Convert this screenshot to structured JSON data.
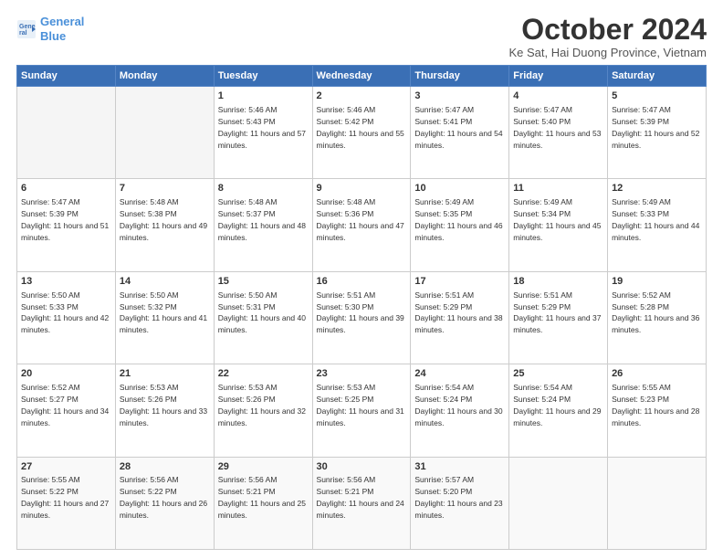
{
  "logo": {
    "line1": "General",
    "line2": "Blue"
  },
  "title": "October 2024",
  "subtitle": "Ke Sat, Hai Duong Province, Vietnam",
  "days_header": [
    "Sunday",
    "Monday",
    "Tuesday",
    "Wednesday",
    "Thursday",
    "Friday",
    "Saturday"
  ],
  "weeks": [
    [
      {
        "num": "",
        "sunrise": "",
        "sunset": "",
        "daylight": ""
      },
      {
        "num": "",
        "sunrise": "",
        "sunset": "",
        "daylight": ""
      },
      {
        "num": "1",
        "sunrise": "Sunrise: 5:46 AM",
        "sunset": "Sunset: 5:43 PM",
        "daylight": "Daylight: 11 hours and 57 minutes."
      },
      {
        "num": "2",
        "sunrise": "Sunrise: 5:46 AM",
        "sunset": "Sunset: 5:42 PM",
        "daylight": "Daylight: 11 hours and 55 minutes."
      },
      {
        "num": "3",
        "sunrise": "Sunrise: 5:47 AM",
        "sunset": "Sunset: 5:41 PM",
        "daylight": "Daylight: 11 hours and 54 minutes."
      },
      {
        "num": "4",
        "sunrise": "Sunrise: 5:47 AM",
        "sunset": "Sunset: 5:40 PM",
        "daylight": "Daylight: 11 hours and 53 minutes."
      },
      {
        "num": "5",
        "sunrise": "Sunrise: 5:47 AM",
        "sunset": "Sunset: 5:39 PM",
        "daylight": "Daylight: 11 hours and 52 minutes."
      }
    ],
    [
      {
        "num": "6",
        "sunrise": "Sunrise: 5:47 AM",
        "sunset": "Sunset: 5:39 PM",
        "daylight": "Daylight: 11 hours and 51 minutes."
      },
      {
        "num": "7",
        "sunrise": "Sunrise: 5:48 AM",
        "sunset": "Sunset: 5:38 PM",
        "daylight": "Daylight: 11 hours and 49 minutes."
      },
      {
        "num": "8",
        "sunrise": "Sunrise: 5:48 AM",
        "sunset": "Sunset: 5:37 PM",
        "daylight": "Daylight: 11 hours and 48 minutes."
      },
      {
        "num": "9",
        "sunrise": "Sunrise: 5:48 AM",
        "sunset": "Sunset: 5:36 PM",
        "daylight": "Daylight: 11 hours and 47 minutes."
      },
      {
        "num": "10",
        "sunrise": "Sunrise: 5:49 AM",
        "sunset": "Sunset: 5:35 PM",
        "daylight": "Daylight: 11 hours and 46 minutes."
      },
      {
        "num": "11",
        "sunrise": "Sunrise: 5:49 AM",
        "sunset": "Sunset: 5:34 PM",
        "daylight": "Daylight: 11 hours and 45 minutes."
      },
      {
        "num": "12",
        "sunrise": "Sunrise: 5:49 AM",
        "sunset": "Sunset: 5:33 PM",
        "daylight": "Daylight: 11 hours and 44 minutes."
      }
    ],
    [
      {
        "num": "13",
        "sunrise": "Sunrise: 5:50 AM",
        "sunset": "Sunset: 5:33 PM",
        "daylight": "Daylight: 11 hours and 42 minutes."
      },
      {
        "num": "14",
        "sunrise": "Sunrise: 5:50 AM",
        "sunset": "Sunset: 5:32 PM",
        "daylight": "Daylight: 11 hours and 41 minutes."
      },
      {
        "num": "15",
        "sunrise": "Sunrise: 5:50 AM",
        "sunset": "Sunset: 5:31 PM",
        "daylight": "Daylight: 11 hours and 40 minutes."
      },
      {
        "num": "16",
        "sunrise": "Sunrise: 5:51 AM",
        "sunset": "Sunset: 5:30 PM",
        "daylight": "Daylight: 11 hours and 39 minutes."
      },
      {
        "num": "17",
        "sunrise": "Sunrise: 5:51 AM",
        "sunset": "Sunset: 5:29 PM",
        "daylight": "Daylight: 11 hours and 38 minutes."
      },
      {
        "num": "18",
        "sunrise": "Sunrise: 5:51 AM",
        "sunset": "Sunset: 5:29 PM",
        "daylight": "Daylight: 11 hours and 37 minutes."
      },
      {
        "num": "19",
        "sunrise": "Sunrise: 5:52 AM",
        "sunset": "Sunset: 5:28 PM",
        "daylight": "Daylight: 11 hours and 36 minutes."
      }
    ],
    [
      {
        "num": "20",
        "sunrise": "Sunrise: 5:52 AM",
        "sunset": "Sunset: 5:27 PM",
        "daylight": "Daylight: 11 hours and 34 minutes."
      },
      {
        "num": "21",
        "sunrise": "Sunrise: 5:53 AM",
        "sunset": "Sunset: 5:26 PM",
        "daylight": "Daylight: 11 hours and 33 minutes."
      },
      {
        "num": "22",
        "sunrise": "Sunrise: 5:53 AM",
        "sunset": "Sunset: 5:26 PM",
        "daylight": "Daylight: 11 hours and 32 minutes."
      },
      {
        "num": "23",
        "sunrise": "Sunrise: 5:53 AM",
        "sunset": "Sunset: 5:25 PM",
        "daylight": "Daylight: 11 hours and 31 minutes."
      },
      {
        "num": "24",
        "sunrise": "Sunrise: 5:54 AM",
        "sunset": "Sunset: 5:24 PM",
        "daylight": "Daylight: 11 hours and 30 minutes."
      },
      {
        "num": "25",
        "sunrise": "Sunrise: 5:54 AM",
        "sunset": "Sunset: 5:24 PM",
        "daylight": "Daylight: 11 hours and 29 minutes."
      },
      {
        "num": "26",
        "sunrise": "Sunrise: 5:55 AM",
        "sunset": "Sunset: 5:23 PM",
        "daylight": "Daylight: 11 hours and 28 minutes."
      }
    ],
    [
      {
        "num": "27",
        "sunrise": "Sunrise: 5:55 AM",
        "sunset": "Sunset: 5:22 PM",
        "daylight": "Daylight: 11 hours and 27 minutes."
      },
      {
        "num": "28",
        "sunrise": "Sunrise: 5:56 AM",
        "sunset": "Sunset: 5:22 PM",
        "daylight": "Daylight: 11 hours and 26 minutes."
      },
      {
        "num": "29",
        "sunrise": "Sunrise: 5:56 AM",
        "sunset": "Sunset: 5:21 PM",
        "daylight": "Daylight: 11 hours and 25 minutes."
      },
      {
        "num": "30",
        "sunrise": "Sunrise: 5:56 AM",
        "sunset": "Sunset: 5:21 PM",
        "daylight": "Daylight: 11 hours and 24 minutes."
      },
      {
        "num": "31",
        "sunrise": "Sunrise: 5:57 AM",
        "sunset": "Sunset: 5:20 PM",
        "daylight": "Daylight: 11 hours and 23 minutes."
      },
      {
        "num": "",
        "sunrise": "",
        "sunset": "",
        "daylight": ""
      },
      {
        "num": "",
        "sunrise": "",
        "sunset": "",
        "daylight": ""
      }
    ]
  ]
}
